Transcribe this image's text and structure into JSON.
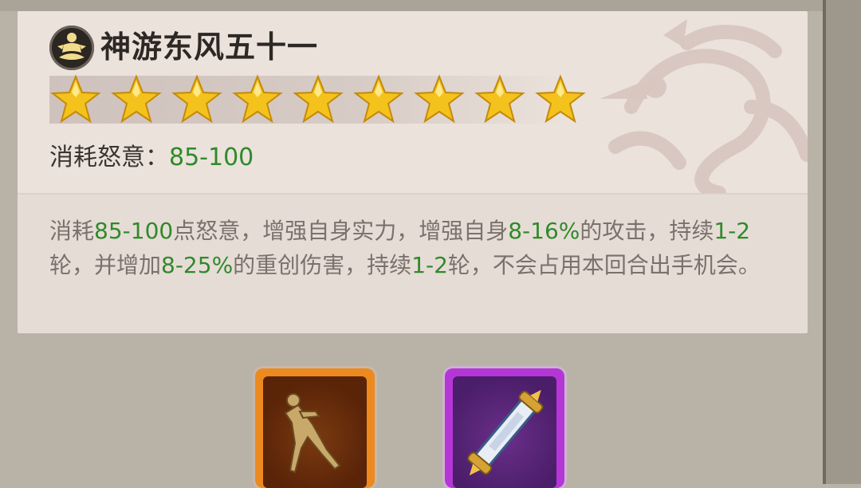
{
  "skill": {
    "name": "神游东风五十一",
    "icon": "meditating-monk-icon",
    "star_count": 9,
    "rage_label": "消耗怒意：",
    "rage_value": "85-100",
    "description": [
      {
        "t": "消耗",
        "hl": false
      },
      {
        "t": "85-100",
        "hl": true
      },
      {
        "t": "点怒意，增强自身实力，增强自身",
        "hl": false
      },
      {
        "t": "8-16%",
        "hl": true
      },
      {
        "t": "的攻击，持续",
        "hl": false
      },
      {
        "t": "1-2",
        "hl": true
      },
      {
        "t": "轮，并增加",
        "hl": false
      },
      {
        "t": "8-25%",
        "hl": true
      },
      {
        "t": "的重创伤害，持续",
        "hl": false
      },
      {
        "t": "1-2",
        "hl": true
      },
      {
        "t": "轮，不会占用本回合出手机会。",
        "hl": false
      }
    ]
  },
  "items": [
    {
      "icon": "golden-figure-icon",
      "rarity_color": "#ec8a1f"
    },
    {
      "icon": "scroll-icon",
      "rarity_color": "#b536d6"
    }
  ],
  "colors": {
    "highlight": "#2f8a2a",
    "text": "#7b716c",
    "star": "#f4c21c"
  }
}
